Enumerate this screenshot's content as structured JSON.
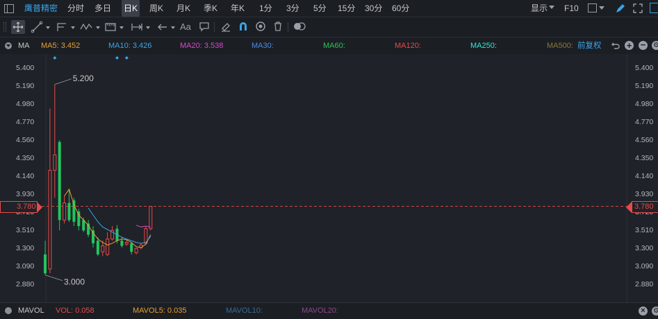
{
  "topbar": {
    "title": "鹰普精密",
    "periods": [
      "分时",
      "多日",
      "日K",
      "周K",
      "月K",
      "季K",
      "年K",
      "1分",
      "3分",
      "5分",
      "15分",
      "30分",
      "60分"
    ],
    "active_period": "日K",
    "display_label": "显示",
    "f10_label": "F10"
  },
  "toolbar": {
    "icons": [
      "move-icon",
      "line-tool-icon",
      "pitchfork-icon",
      "wave-tool-icon",
      "measure-icon",
      "range-icon",
      "arrow-icon",
      "text-icon",
      "comment-icon",
      "eraser-icon",
      "magnet-icon",
      "eye-icon",
      "trash-icon",
      "toggle-icon"
    ]
  },
  "ma_bar": {
    "label": "MA",
    "items": [
      {
        "label": "MA5: 3.452",
        "color": "#e8a033"
      },
      {
        "label": "MA10: 3.426",
        "color": "#3aa4e8"
      },
      {
        "label": "MA20: 3.538",
        "color": "#d848c8"
      },
      {
        "label": "MA30:",
        "color": "#4a8ce8"
      },
      {
        "label": "MA60:",
        "color": "#2ec25a"
      },
      {
        "label": "MA120:",
        "color": "#e84a4a"
      },
      {
        "label": "MA250:",
        "color": "#2ee8d8"
      },
      {
        "label": "MA500:",
        "color": "#8a7a3a"
      }
    ],
    "adjust_label": "前复权"
  },
  "chart_data": {
    "type": "candlestick",
    "y_ticks": [
      "5.400",
      "5.190",
      "4.980",
      "4.770",
      "4.560",
      "4.350",
      "4.140",
      "3.930",
      "3.720",
      "3.510",
      "3.300",
      "3.090",
      "2.880"
    ],
    "ylim": [
      2.88,
      5.4
    ],
    "current_price": "3.780",
    "high_label": "5.200",
    "low_label": "3.000",
    "candles": [
      {
        "o": 3.22,
        "h": 3.38,
        "c": 3.0,
        "l": 2.98
      },
      {
        "o": 3.05,
        "h": 4.92,
        "c": 4.2,
        "l": 3.0
      },
      {
        "o": 4.2,
        "h": 5.2,
        "c": 4.38,
        "l": 3.88
      },
      {
        "o": 4.53,
        "h": 4.55,
        "c": 3.62,
        "l": 3.5
      },
      {
        "o": 3.62,
        "h": 3.9,
        "c": 3.82,
        "l": 3.58
      },
      {
        "o": 3.82,
        "h": 3.98,
        "c": 3.62,
        "l": 3.6
      },
      {
        "o": 3.85,
        "h": 3.88,
        "c": 3.6,
        "l": 3.55
      },
      {
        "o": 3.72,
        "h": 3.75,
        "c": 3.55,
        "l": 3.5
      },
      {
        "o": 3.62,
        "h": 3.65,
        "c": 3.5,
        "l": 3.48
      },
      {
        "o": 3.58,
        "h": 3.62,
        "c": 3.45,
        "l": 3.42
      },
      {
        "o": 3.5,
        "h": 3.55,
        "c": 3.35,
        "l": 3.3
      },
      {
        "o": 3.38,
        "h": 3.42,
        "c": 3.22,
        "l": 3.2
      },
      {
        "o": 3.25,
        "h": 3.38,
        "c": 3.32,
        "l": 3.2
      },
      {
        "o": 3.22,
        "h": 3.48,
        "c": 3.4,
        "l": 3.2
      },
      {
        "o": 3.4,
        "h": 3.55,
        "c": 3.5,
        "l": 3.38
      },
      {
        "o": 3.52,
        "h": 3.56,
        "c": 3.38,
        "l": 3.35
      },
      {
        "o": 3.38,
        "h": 3.42,
        "c": 3.32,
        "l": 3.3
      },
      {
        "o": 3.34,
        "h": 3.4,
        "c": 3.36,
        "l": 3.32
      },
      {
        "o": 3.35,
        "h": 3.36,
        "c": 3.25,
        "l": 3.22
      },
      {
        "o": 3.24,
        "h": 3.3,
        "c": 3.29,
        "l": 3.22
      },
      {
        "o": 3.3,
        "h": 3.35,
        "c": 3.33,
        "l": 3.28
      },
      {
        "o": 3.35,
        "h": 3.55,
        "c": 3.52,
        "l": 3.33
      },
      {
        "o": 3.52,
        "h": 3.78,
        "c": 3.78,
        "l": 3.5
      }
    ],
    "ma5": [
      null,
      null,
      null,
      null,
      3.9,
      3.98,
      3.8,
      3.68,
      3.62,
      3.56,
      3.47,
      3.4,
      3.36,
      3.33,
      3.35,
      3.38,
      3.4,
      3.39,
      3.36,
      3.31,
      3.3,
      3.34,
      3.45
    ],
    "ma10": [
      null,
      null,
      null,
      null,
      null,
      null,
      null,
      null,
      null,
      3.76,
      3.68,
      3.6,
      3.54,
      3.51,
      3.48,
      3.45,
      3.42,
      3.4,
      3.38,
      3.36,
      3.35,
      3.36,
      3.43
    ],
    "ma20": [
      null,
      null,
      null,
      null,
      null,
      null,
      null,
      null,
      null,
      null,
      null,
      null,
      null,
      null,
      null,
      null,
      null,
      null,
      null,
      3.56,
      3.54,
      3.55,
      3.54
    ]
  },
  "vol_bar": {
    "label": "MAVOL",
    "items": [
      {
        "label": "VOL: 0.058",
        "color": "#e84a4a"
      },
      {
        "label": "MAVOL5: 0.035",
        "color": "#e8a033"
      },
      {
        "label": "MAVOL10:",
        "color": "#3a6a9a"
      },
      {
        "label": "MAVOL20:",
        "color": "#8a4a8a"
      }
    ]
  }
}
